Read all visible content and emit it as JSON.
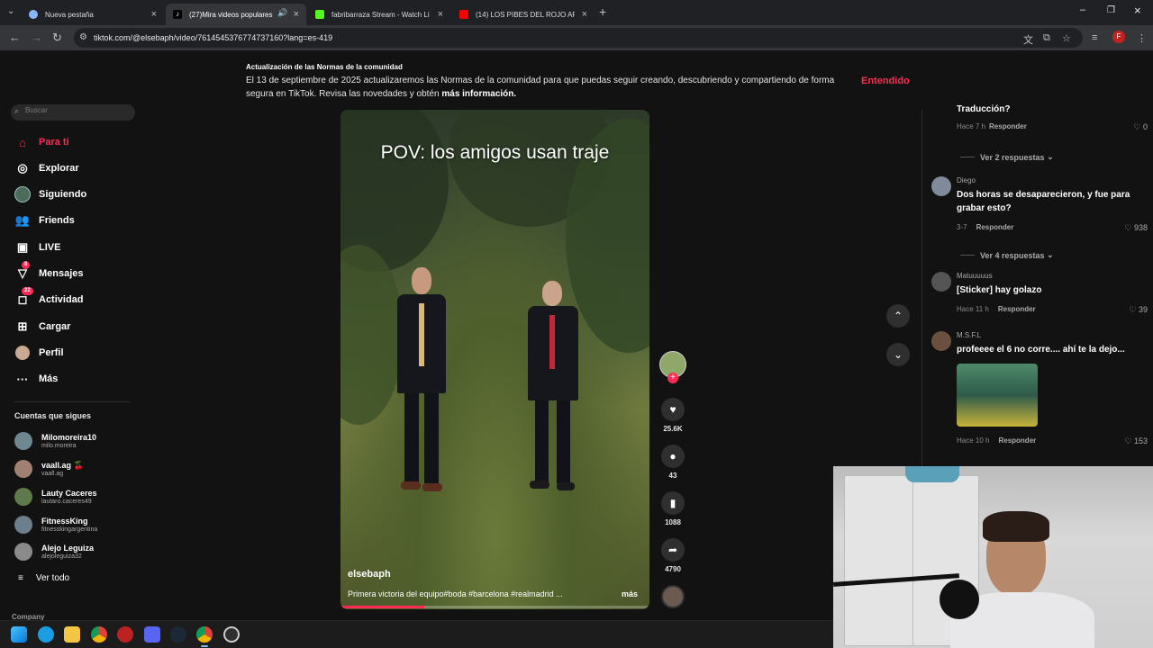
{
  "browser": {
    "tabs": [
      {
        "title": "Nueva pestaña",
        "color": "#8ab4f8",
        "active": false
      },
      {
        "title": "(27)Mira videos populares",
        "color": "#ffffff",
        "active": true
      },
      {
        "title": "fabribarraza Stream - Watch Li",
        "color": "#53fc18",
        "active": false
      },
      {
        "title": "(14) LOS PIBES DEL ROJO ARM",
        "color": "#ff0000",
        "active": false
      }
    ],
    "url": "tiktok.com/@elsebaph/video/7614545376774737160?lang=es-419",
    "profile_initial": "F"
  },
  "banner": {
    "heading": "Actualización de las Normas de la comunidad",
    "text": "El 13 de septiembre de 2025 actualizaremos las Normas de la comunidad para que puedas seguir creando, descubriendo y compartiendo de forma segura en TikTok. Revisa las novedades y obtén",
    "link": "más información.",
    "button": "Entendido"
  },
  "sidebar": {
    "search_placeholder": "Buscar",
    "nav": [
      {
        "label": "Para ti",
        "icon": "home-icon"
      },
      {
        "label": "Explorar",
        "icon": "compass-icon"
      },
      {
        "label": "Siguiendo",
        "icon": "following-icon"
      },
      {
        "label": "Friends",
        "icon": "friends-icon"
      },
      {
        "label": "LIVE",
        "icon": "live-icon"
      },
      {
        "label": "Mensajes",
        "icon": "message-icon",
        "badge": "8"
      },
      {
        "label": "Actividad",
        "icon": "activity-icon",
        "badge": "22"
      },
      {
        "label": "Cargar",
        "icon": "upload-icon"
      },
      {
        "label": "Perfil",
        "icon": "profile-icon"
      },
      {
        "label": "Más",
        "icon": "more-icon"
      }
    ],
    "following_title": "Cuentas que sigues",
    "accounts": [
      {
        "name": "Milomoreira10",
        "handle": "milo.moreira"
      },
      {
        "name": "vaall.ag 🍒",
        "handle": "vaall.ag"
      },
      {
        "name": "Lauty Caceres",
        "handle": "lautaro.caceres49"
      },
      {
        "name": "FitnessKing",
        "handle": "fitnesskingargentina"
      },
      {
        "name": "Alejo Leguiza",
        "handle": "alejoleguiza32"
      }
    ],
    "see_all": "Ver todo",
    "company": "Company"
  },
  "video": {
    "caption": "POV: los amigos usan traje",
    "author": "elsebaph",
    "description": "Primera victoria del equipo#boda #barcelona #realmadrid ...",
    "more": "más",
    "progress": 0.27
  },
  "actions": {
    "likes": "25.6K",
    "comments": "43",
    "saves": "1088",
    "shares": "4790"
  },
  "comments": {
    "top_partial": {
      "text": "Traducción?",
      "time": "Hace 7 h",
      "reply": "Responder",
      "likes": "0"
    },
    "view_replies_1": "Ver 2 respuestas",
    "items": [
      {
        "user": "Diego",
        "text": "Dos horas se desaparecieron, y fue para grabar esto?",
        "time": "3-7",
        "reply": "Responder",
        "likes": "938"
      },
      {
        "user": "Matuuuuus",
        "text": "[Sticker] hay golazo",
        "time": "Hace 11 h",
        "reply": "Responder",
        "likes": "39"
      },
      {
        "user": "M.S.F.L",
        "text": "profeeee el 6 no corre.... ahí te la dejo...",
        "time": "Hace 10 h",
        "reply": "Responder",
        "likes": "153"
      }
    ],
    "view_replies_2": "Ver 4 respuestas"
  }
}
